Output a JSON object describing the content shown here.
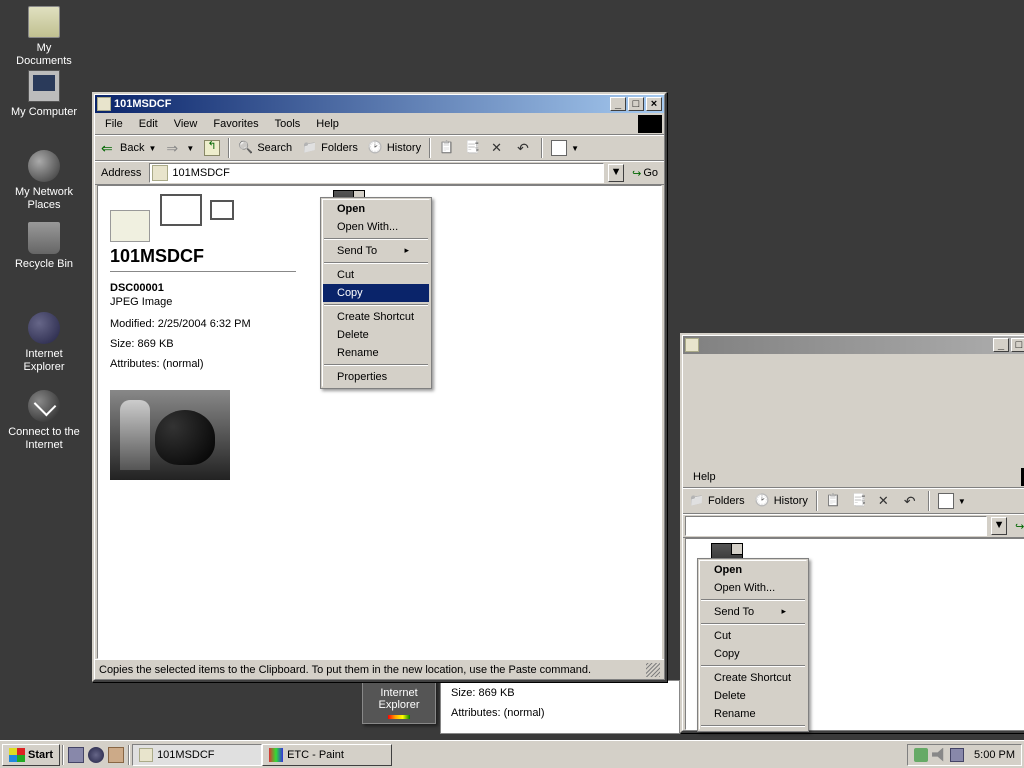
{
  "desktop": {
    "icons": [
      {
        "label": "My Documents"
      },
      {
        "label": "My Computer"
      },
      {
        "label": "My Network Places"
      },
      {
        "label": "Recycle Bin"
      },
      {
        "label": "Internet Explorer"
      },
      {
        "label": "Connect to the Internet"
      }
    ]
  },
  "window1": {
    "title": "101MSDCF",
    "menus": {
      "file": "File",
      "edit": "Edit",
      "view": "View",
      "favorites": "Favorites",
      "tools": "Tools",
      "help": "Help"
    },
    "toolbar": {
      "back": "Back",
      "search": "Search",
      "folders": "Folders",
      "history": "History"
    },
    "address": {
      "label": "Address",
      "value": "101MSDCF",
      "go": "Go"
    },
    "folder_heading": "101MSDCF",
    "file": {
      "name": "DSC00001",
      "type": "JPEG Image",
      "modified_label": "Modified:",
      "modified_value": "2/25/2004 6:32 PM",
      "size_label": "Size:",
      "size_value": "869 KB",
      "attrs_label": "Attributes:",
      "attrs_value": "(normal)"
    },
    "status": "Copies the selected items to the Clipboard. To put them in the new location, use the Paste command."
  },
  "window2": {
    "menus": {
      "help": "Help"
    },
    "toolbar": {
      "folders": "Folders",
      "history": "History",
      "go": "Go"
    },
    "file": {
      "size_label": "Size:",
      "size_value": "869 KB",
      "attrs_label": "Attributes:",
      "attrs_value": "(normal)"
    }
  },
  "context_menu": {
    "open": "Open",
    "open_with": "Open With...",
    "send_to": "Send To",
    "cut": "Cut",
    "copy": "Copy",
    "create_shortcut": "Create Shortcut",
    "delete": "Delete",
    "rename": "Rename",
    "properties": "Properties"
  },
  "ie_label": "Internet Explorer",
  "taskbar": {
    "start": "Start",
    "task1": "101MSDCF",
    "task2": "ETC - Paint",
    "clock": "5:00 PM"
  }
}
